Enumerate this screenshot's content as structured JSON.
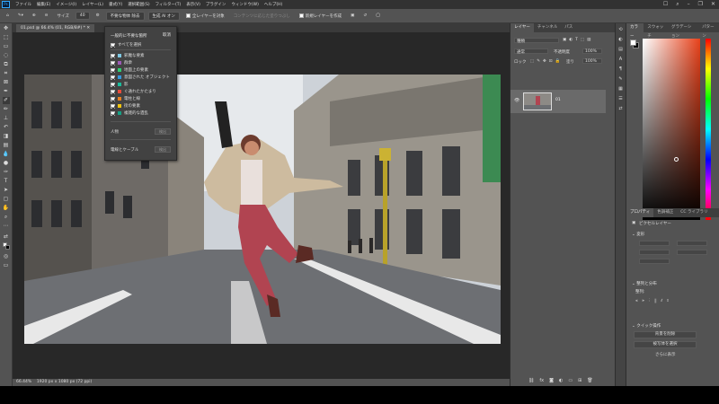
{
  "menubar": {
    "logo": "Ps",
    "items": [
      "ファイル",
      "編集(E)",
      "イメージ(I)",
      "レイヤー(L)",
      "書式(Y)",
      "選択範囲(S)",
      "フィルター(T)",
      "表示(V)",
      "プラグイン",
      "ウィンドウ(W)",
      "ヘルプ(H)"
    ]
  },
  "options_bar": {
    "size_label": "サイズ",
    "size_value": "40",
    "sample_all_layers": "全レイヤーを対象",
    "object_selection": "不要な物体 除去",
    "generate": "生成 AI オン",
    "new_layer": "新規レイヤーを作成",
    "fill_label": "コンテンツに応じた塗りつぶし"
  },
  "document": {
    "tab_title": "01.psd @ 66.4% (01, RGB/8#) *",
    "zoom": "66.44%",
    "dimensions": "1920 px x 1080 px (72 ppi)"
  },
  "dropdown": {
    "header": "一般的に不要な箇所",
    "cancel": "取消",
    "select_all": "すべてを選択",
    "items": [
      {
        "label": "邪魔な要素",
        "color": "#7ec8e3"
      },
      {
        "label": "群衆",
        "color": "#9b59b6"
      },
      {
        "label": "地面上の要素",
        "color": "#2ecc71"
      },
      {
        "label": "意図された オブジェクト",
        "color": "#3498db"
      },
      {
        "label": "影",
        "color": "#1abc9c"
      },
      {
        "label": "ぐ通れたかたまり",
        "color": "#e74c3c"
      },
      {
        "label": "電柱と線",
        "color": "#e67e22"
      },
      {
        "label": "街の要素",
        "color": "#f1c40f"
      },
      {
        "label": "複雑的な遺乱",
        "color": "#16a085"
      }
    ],
    "person_label": "人物",
    "person_btn": "検出",
    "cables_label": "電線とケーブル",
    "cables_btn": "検出"
  },
  "layers_panel": {
    "tabs": [
      "レイヤー",
      "チャンネル",
      "パス"
    ],
    "search_placeholder": "種類",
    "blend_mode": "通常",
    "opacity_label": "不透明度",
    "opacity_value": "100%",
    "lock_label": "ロック",
    "fill_label": "塗り",
    "fill_value": "100%",
    "layer_name": "01"
  },
  "color_panel": {
    "tabs": [
      "カラー",
      "スウォッチ",
      "グラデーション",
      "パターン"
    ]
  },
  "properties_panel": {
    "tabs": [
      "プロパティ",
      "色調補正",
      "CC ライブラリ"
    ],
    "kind": "ピクセルレイヤー",
    "transform": "変形",
    "align": "整列と分布",
    "align_sub": "整列:",
    "quick_actions": "クイック操作",
    "qa_btn1": "背景を削除",
    "qa_btn2": "被写体を選択",
    "more": "さらに表示"
  },
  "colors": {
    "accent": "#31a8ff",
    "ui_bg": "#535353",
    "dark_bg": "#282828"
  }
}
